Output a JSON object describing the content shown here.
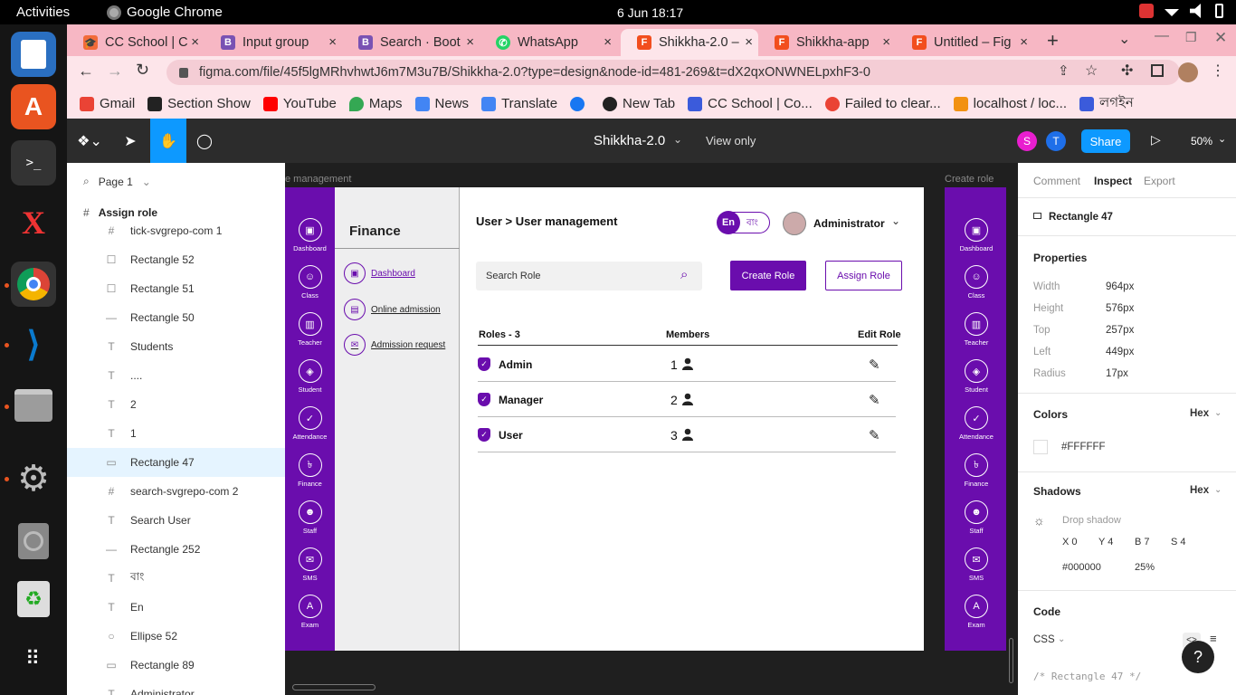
{
  "system": {
    "activities": "Activities",
    "app_name": "Google Chrome",
    "clock": "6 Jun  18:17"
  },
  "browser": {
    "tabs": [
      {
        "label": "CC School | C",
        "color": "#f26b3a"
      },
      {
        "label": "Input group",
        "color": "#7952b3"
      },
      {
        "label": "Search · Boot",
        "color": "#7952b3"
      },
      {
        "label": "WhatsApp",
        "color": "#25d366"
      },
      {
        "label": "Shikkha-2.0 –",
        "color": "#f24e1e"
      },
      {
        "label": "Shikkha-app",
        "color": "#f24e1e"
      },
      {
        "label": "Untitled – Fig",
        "color": "#f24e1e"
      }
    ],
    "url": "figma.com/file/45f5lgMRhvhwtJ6m7M3u7B/Shikkha-2.0?type=design&node-id=481-269&t=dX2qxONWNELpxhF3-0",
    "bookmarks": [
      "Gmail",
      "Section Show",
      "YouTube",
      "Maps",
      "News",
      "Translate",
      "",
      "New Tab",
      "CC School | Co...",
      "Failed to clear...",
      "localhost / loc...",
      "লগইন"
    ]
  },
  "figma": {
    "file_title": "Shikkha-2.0",
    "view_mode": "View only",
    "share_label": "Share",
    "zoom": "50%",
    "avatars": [
      "S",
      "T"
    ],
    "page_label": "Page 1",
    "frame_label": "Assign role",
    "layers": [
      {
        "label": "tick-svgrepo-com 1",
        "icon": "#"
      },
      {
        "label": "Rectangle 52",
        "icon": "☐"
      },
      {
        "label": "Rectangle 51",
        "icon": "☐"
      },
      {
        "label": "Rectangle 50",
        "icon": "—"
      },
      {
        "label": "Students",
        "icon": "T"
      },
      {
        "label": "....",
        "icon": "T"
      },
      {
        "label": "2",
        "icon": "T"
      },
      {
        "label": "1",
        "icon": "T"
      },
      {
        "label": "Rectangle 47",
        "icon": "▭"
      },
      {
        "label": "search-svgrepo-com 2",
        "icon": "#"
      },
      {
        "label": "Search User",
        "icon": "T"
      },
      {
        "label": "Rectangle 252",
        "icon": "—"
      },
      {
        "label": "বাং",
        "icon": "T"
      },
      {
        "label": "En",
        "icon": "T"
      },
      {
        "label": "Ellipse 52",
        "icon": "○"
      },
      {
        "label": "Rectangle 89",
        "icon": "▭"
      },
      {
        "label": "Administrator",
        "icon": "T"
      }
    ],
    "canvas_labels": {
      "left": "e management",
      "right": "Create role"
    },
    "inspect": {
      "tabs": [
        "Comment",
        "Inspect",
        "Export"
      ],
      "selected_name": "Rectangle 47",
      "properties_title": "Properties",
      "props": [
        {
          "k": "Width",
          "v": "964px"
        },
        {
          "k": "Height",
          "v": "576px"
        },
        {
          "k": "Top",
          "v": "257px"
        },
        {
          "k": "Left",
          "v": "449px"
        },
        {
          "k": "Radius",
          "v": "17px"
        }
      ],
      "colors_title": "Colors",
      "hex_label": "Hex",
      "color_value": "#FFFFFF",
      "shadows_title": "Shadows",
      "shadow_type": "Drop shadow",
      "shadow": {
        "x": "X 0",
        "y": "Y 4",
        "b": "B 7",
        "s": "S 4",
        "color": "#000000",
        "opacity": "25%"
      },
      "code_title": "Code",
      "code_lang": "CSS",
      "code_comment": "/* Rectangle 47 */"
    }
  },
  "design": {
    "sidebar": [
      "Dashboard",
      "Class",
      "Teacher",
      "Student",
      "Attendance",
      "Finance",
      "Staff",
      "SMS",
      "Exam"
    ],
    "section_title": "Finance",
    "subnav": [
      "Dashboard",
      "Online admission",
      "Admission request"
    ],
    "breadcrumb": "User > User management",
    "lang": {
      "en": "En",
      "bn": "বাং"
    },
    "user_name": "Administrator",
    "search_placeholder": "Search Role",
    "create_button": "Create Role",
    "assign_button": "Assign Role",
    "table_headers": {
      "roles": "Roles - 3",
      "members": "Members",
      "edit": "Edit Role"
    },
    "roles": [
      {
        "name": "Admin",
        "members": "1"
      },
      {
        "name": "Manager",
        "members": "2"
      },
      {
        "name": "User",
        "members": "3"
      }
    ],
    "accent": "#6a0dad"
  }
}
